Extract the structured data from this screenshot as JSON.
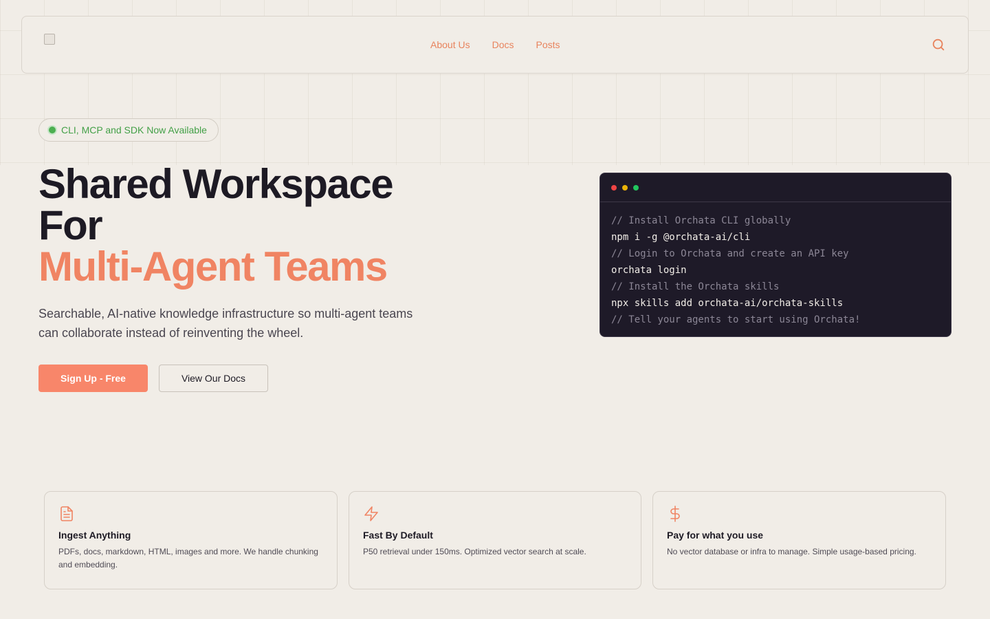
{
  "nav": {
    "links": [
      {
        "label": "About Us"
      },
      {
        "label": "Docs"
      },
      {
        "label": "Posts"
      }
    ],
    "search_icon": "search-icon"
  },
  "hero": {
    "badge": "CLI, MCP and SDK Now Available",
    "title_line1": "Shared Workspace",
    "title_line2": "For",
    "title_accent": "Multi-Agent Teams",
    "subtitle": "Searchable, AI-native knowledge infrastructure so multi-agent teams can collaborate instead of reinventing the wheel.",
    "primary_button": "Sign Up - Free",
    "secondary_button": "View Our Docs"
  },
  "terminal": {
    "lines": [
      {
        "type": "comment",
        "text": "// Install Orchata CLI globally"
      },
      {
        "type": "cmd",
        "text": "npm i -g @orchata-ai/cli"
      },
      {
        "type": "comment",
        "text": "// Login to Orchata and create an API key"
      },
      {
        "type": "cmd",
        "text": "orchata login"
      },
      {
        "type": "comment",
        "text": "// Install the Orchata skills"
      },
      {
        "type": "cmd",
        "text": "npx skills add orchata-ai/orchata-skills"
      },
      {
        "type": "comment",
        "text": "// Tell your agents to start using Orchata!"
      }
    ]
  },
  "features": [
    {
      "icon": "document-icon",
      "title": "Ingest Anything",
      "desc": "PDFs, docs, markdown, HTML, images and more. We handle chunking and embedding."
    },
    {
      "icon": "lightning-icon",
      "title": "Fast By Default",
      "desc": "P50 retrieval under 150ms. Optimized vector search at scale."
    },
    {
      "icon": "dollar-icon",
      "title": "Pay for what you use",
      "desc": "No vector database or infra to manage. Simple usage-based pricing."
    }
  ],
  "colors": {
    "accent": "#f08463",
    "background": "#f1ede7",
    "terminal_bg": "#1e1a28",
    "badge_green": "#43a047"
  }
}
